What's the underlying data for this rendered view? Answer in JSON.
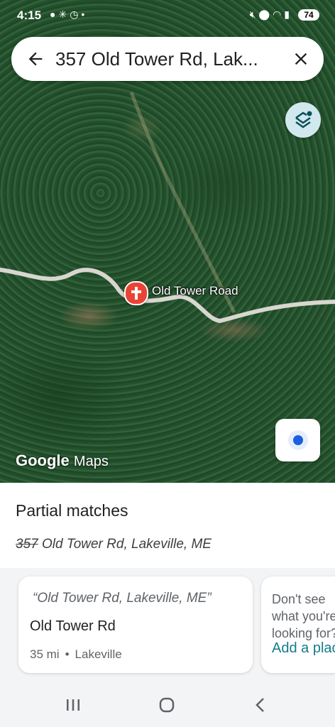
{
  "status_bar": {
    "time": "4:15",
    "left_icons": [
      "chat-icon",
      "sparkle-icon",
      "clock-icon",
      "dot-icon"
    ],
    "right_icons": [
      "mute-icon",
      "location-icon",
      "wifi-icon",
      "signal-icon"
    ],
    "battery": "74"
  },
  "search": {
    "query": "357 Old Tower Rd, Lak..."
  },
  "map": {
    "pin_label": "Old Tower Road",
    "watermark_google": "Google",
    "watermark_maps": "Maps"
  },
  "results": {
    "title": "Partial matches",
    "query_struck": "357",
    "query_rest": " Old Tower Rd, Lakeville, ME",
    "cards": [
      {
        "quote": "“Old Tower Rd, Lakeville, ME”",
        "name": "Old Tower Rd",
        "distance": "35 mi",
        "separator": "•",
        "locality": "Lakeville"
      },
      {
        "text": "Don't see what you're looking for?",
        "link": "Add a place"
      }
    ]
  },
  "colors": {
    "pin": "#ea4335",
    "link": "#137c8b",
    "location_dot": "#1a5fe0",
    "layers_button": "#d1e8ee"
  }
}
